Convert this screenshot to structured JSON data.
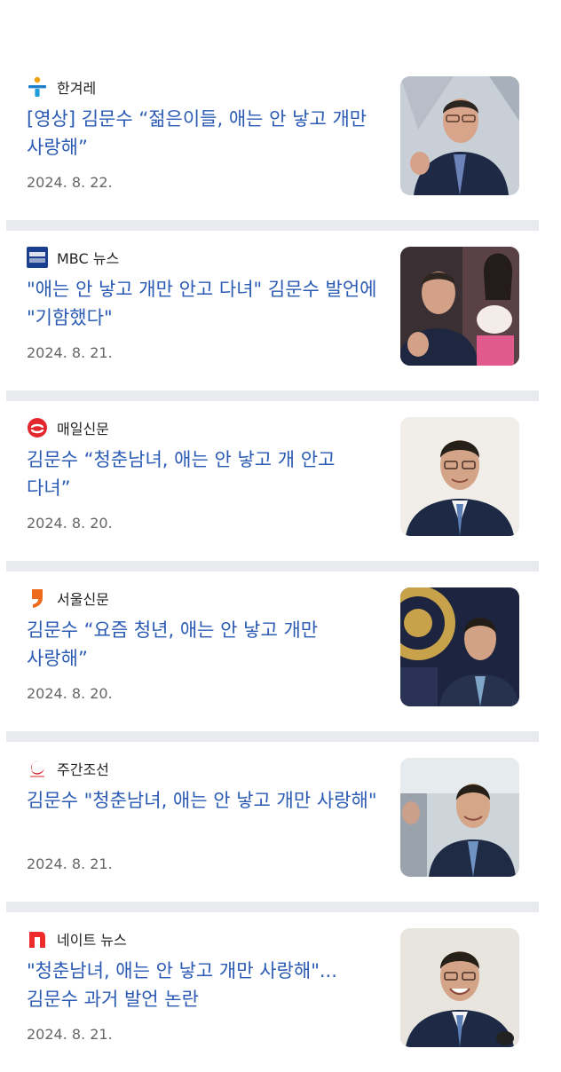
{
  "articles": [
    {
      "source": "한겨레",
      "logo": "hani-logo-icon",
      "headline": "[영상] 김문수 “젊은이들, 애는 안 낳고 개만 사랑해”",
      "date": "2024. 8. 22.",
      "thumbnail": "man-gesturing-photo"
    },
    {
      "source": "MBC 뉴스",
      "logo": "mbc-news-logo-icon",
      "headline": "\"애는 안 낳고 개만 안고 다녀\" 김문수 발언에 \"기함했다\"",
      "date": "2024. 8. 21.",
      "thumbnail": "man-and-woman-with-dog-photo"
    },
    {
      "source": "매일신문",
      "logo": "maeil-logo-icon",
      "headline": "김문수 “청춘남녀, 애는 안 낳고 개 안고 다녀”",
      "date": "2024. 8. 20.",
      "thumbnail": "man-portrait-photo"
    },
    {
      "source": "서울신문",
      "logo": "seoul-shinmun-logo-icon",
      "headline": "김문수 “요즘 청년, 애는 안 낳고 개만 사랑해”",
      "date": "2024. 8. 20.",
      "thumbnail": "man-with-emblem-photo"
    },
    {
      "source": "주간조선",
      "logo": "weekly-chosun-logo-icon",
      "headline": "김문수 \"청춘남녀, 애는 안 낳고 개만 사랑해\"",
      "date": "2024. 8. 21.",
      "thumbnail": "man-walking-photo"
    },
    {
      "source": "네이트 뉴스",
      "logo": "nate-logo-icon",
      "headline": "\"청춘남녀, 애는 안 낳고 개만 사랑해\"...김문수 과거 발언 논란",
      "date": "2024. 8. 21.",
      "thumbnail": "man-smiling-photo"
    }
  ],
  "colors": {
    "headline": "#2a5ab3",
    "separator": "#e9eaee",
    "date": "#666666"
  }
}
